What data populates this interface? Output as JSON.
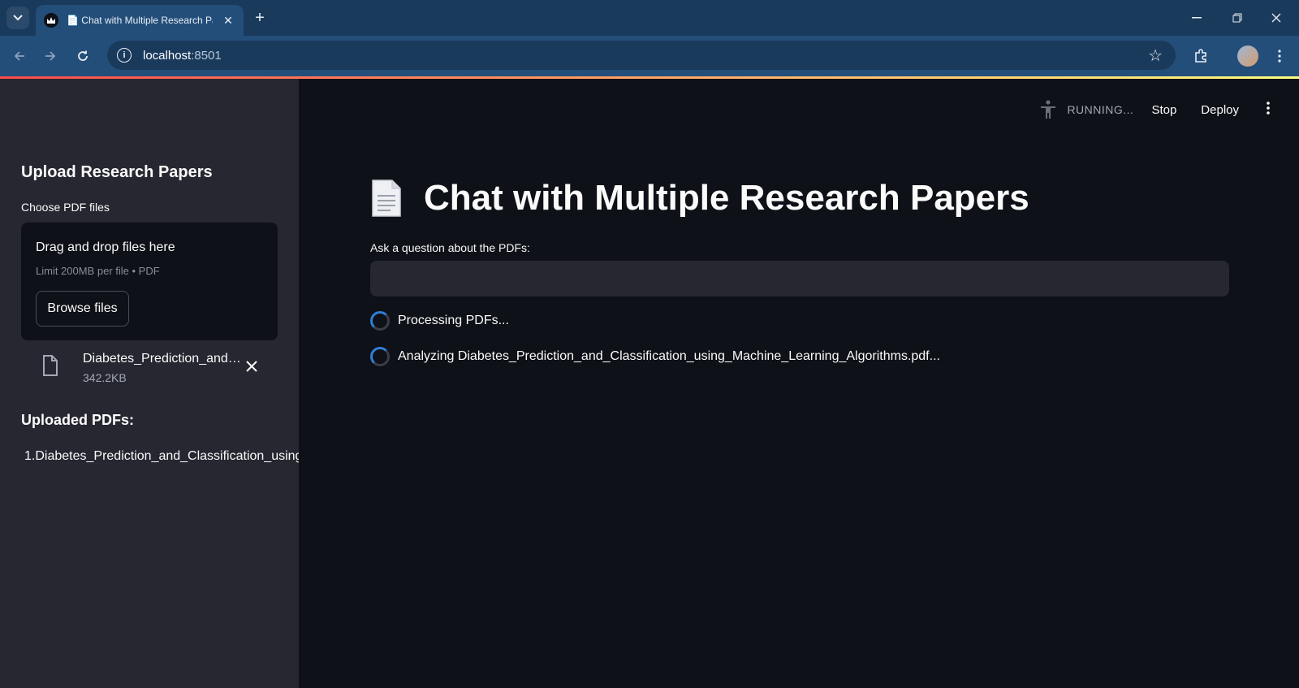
{
  "browser": {
    "tab_title": "📄 Chat with Multiple Research Papers",
    "url_host": "localhost",
    "url_port": ":8501",
    "new_tab_glyph": "+",
    "close_glyph": "✕"
  },
  "sidebar": {
    "heading": "Upload Research Papers",
    "uploader_label": "Choose PDF files",
    "dropzone_title": "Drag and drop files here",
    "dropzone_limit": "Limit 200MB per file • PDF",
    "browse_label": "Browse files",
    "uploaded_file": {
      "name": "Diabetes_Prediction_and_Classification_using_Machine_Learning_Algorithms.pdf",
      "size": "342.2KB"
    },
    "uploaded_heading": "Uploaded PDFs:",
    "uploaded_list": [
      {
        "num": "1.",
        "name": "Diabetes_Prediction_and_Classification_using_Machine_Learning_Algorithms.pdf"
      }
    ]
  },
  "header": {
    "status": "RUNNING...",
    "stop_label": "Stop",
    "deploy_label": "Deploy"
  },
  "main": {
    "title": "Chat with Multiple Research Papers",
    "question_label": "Ask a question about the PDFs:",
    "question_value": "",
    "status_messages": [
      "Processing PDFs...",
      "Analyzing Diabetes_Prediction_and_Classification_using_Machine_Learning_Algorithms.pdf..."
    ]
  },
  "colors": {
    "background": "#0e1117",
    "sidebar": "#262730",
    "accent_gradient_start": "#ff4b4b",
    "accent_gradient_end": "#fffd80",
    "browser_frame": "#234e79"
  },
  "icons": [
    "tab-list-icon",
    "streamlit-crown-icon",
    "back-arrow-icon",
    "forward-arrow-icon",
    "reload-icon",
    "site-info-icon",
    "star-icon",
    "extensions-icon",
    "profile-avatar",
    "browser-menu-icon",
    "file-icon",
    "close-icon",
    "accessibility-person-icon",
    "kebab-menu-icon",
    "document-icon",
    "spinner-icon"
  ]
}
